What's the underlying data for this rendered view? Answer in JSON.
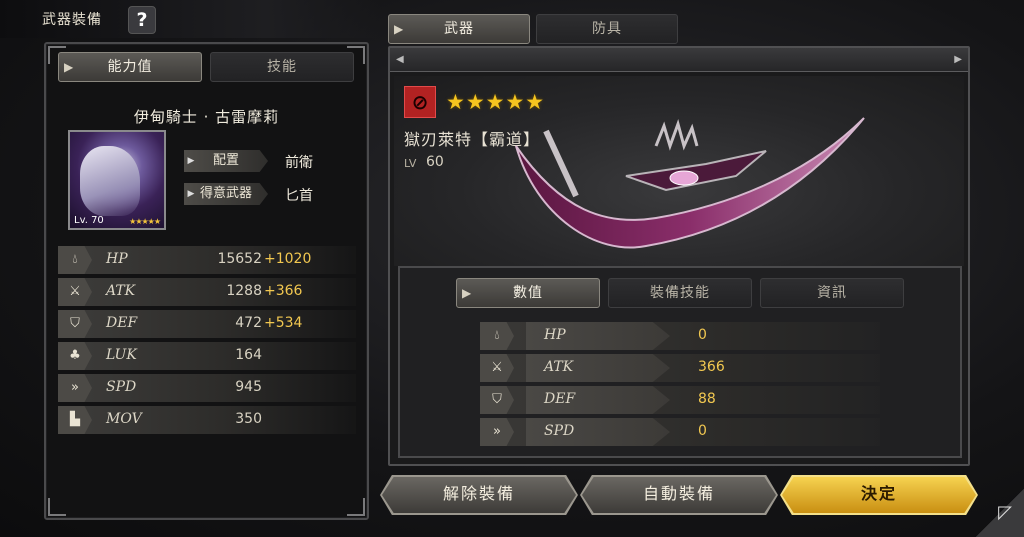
{
  "header": {
    "title": "武器裝備",
    "help_icon": "?"
  },
  "left_panel": {
    "tabs": [
      {
        "label": "能力值",
        "active": true
      },
      {
        "label": "技能",
        "active": false
      }
    ],
    "character": {
      "name": "伊甸騎士 · 古雷摩莉",
      "level_text": "Lv. 70",
      "stars": "★★★★★",
      "placement_label": "配置",
      "placement_value": "前衛",
      "weapon_label": "得意武器",
      "weapon_value": "匕首"
    },
    "stats": [
      {
        "name": "HP",
        "value": "15652",
        "bonus": "+1020",
        "icon": "drop-icon"
      },
      {
        "name": "ATK",
        "value": "1288",
        "bonus": "+366",
        "icon": "sword-icon"
      },
      {
        "name": "DEF",
        "value": "472",
        "bonus": "+534",
        "icon": "shield-icon"
      },
      {
        "name": "LUK",
        "value": "164",
        "bonus": "",
        "icon": "clover-icon"
      },
      {
        "name": "SPD",
        "value": "945",
        "bonus": "",
        "icon": "speed-icon"
      },
      {
        "name": "MOV",
        "value": "350",
        "bonus": "",
        "icon": "boot-icon"
      }
    ]
  },
  "right_panel": {
    "tabs": [
      {
        "label": "武器",
        "active": true
      },
      {
        "label": "防具",
        "active": false
      }
    ],
    "weapon": {
      "stars": "★★★★★",
      "name": "獄刃萊特【霸道】",
      "level_label": "LV",
      "level": "60"
    },
    "sub_tabs": [
      {
        "label": "數值",
        "active": true
      },
      {
        "label": "裝備技能",
        "active": false
      },
      {
        "label": "資訊",
        "active": false
      }
    ],
    "weapon_stats": [
      {
        "name": "HP",
        "value": "0",
        "icon": "drop-icon"
      },
      {
        "name": "ATK",
        "value": "366",
        "icon": "sword-icon"
      },
      {
        "name": "DEF",
        "value": "88",
        "icon": "shield-icon"
      },
      {
        "name": "SPD",
        "value": "0",
        "icon": "speed-icon"
      }
    ]
  },
  "buttons": {
    "unequip": "解除裝備",
    "auto_equip": "自動裝備",
    "confirm": "決定"
  },
  "colors": {
    "accent_gold": "#f2c850",
    "star": "#f5c41f",
    "weapon_type": "#b22222"
  }
}
